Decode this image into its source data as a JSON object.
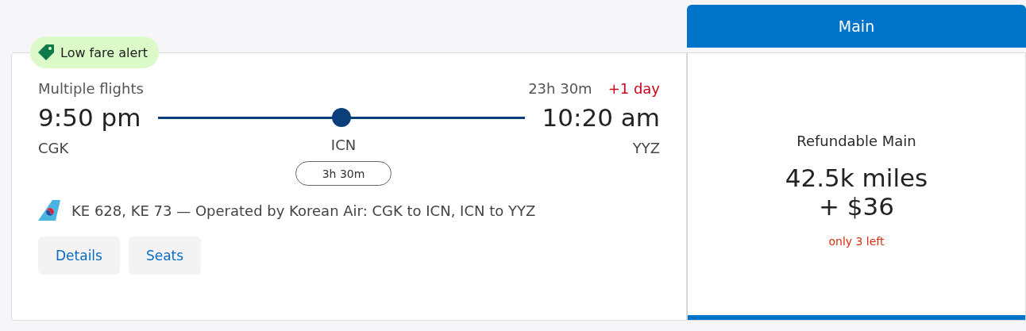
{
  "badge": {
    "label": "Low fare alert"
  },
  "flight": {
    "summary": "Multiple flights",
    "duration": "23h 30m",
    "day_offset": "+1 day",
    "depart_time": "9:50 pm",
    "arrive_time": "10:20 am",
    "origin": "CGK",
    "destination": "YYZ",
    "stops": [
      {
        "code": "ICN",
        "layover": "3h 30m"
      }
    ],
    "operator": "KE 628, KE 73 — Operated by Korean Air: CGK to ICN, ICN to YYZ"
  },
  "actions": [
    "Details",
    "Seats"
  ],
  "fare_column": {
    "title": "Main"
  },
  "fare": {
    "name": "Refundable Main",
    "miles": "42.5k miles",
    "cash": "+ $36",
    "availability": "only 3 left",
    "selected": true
  }
}
